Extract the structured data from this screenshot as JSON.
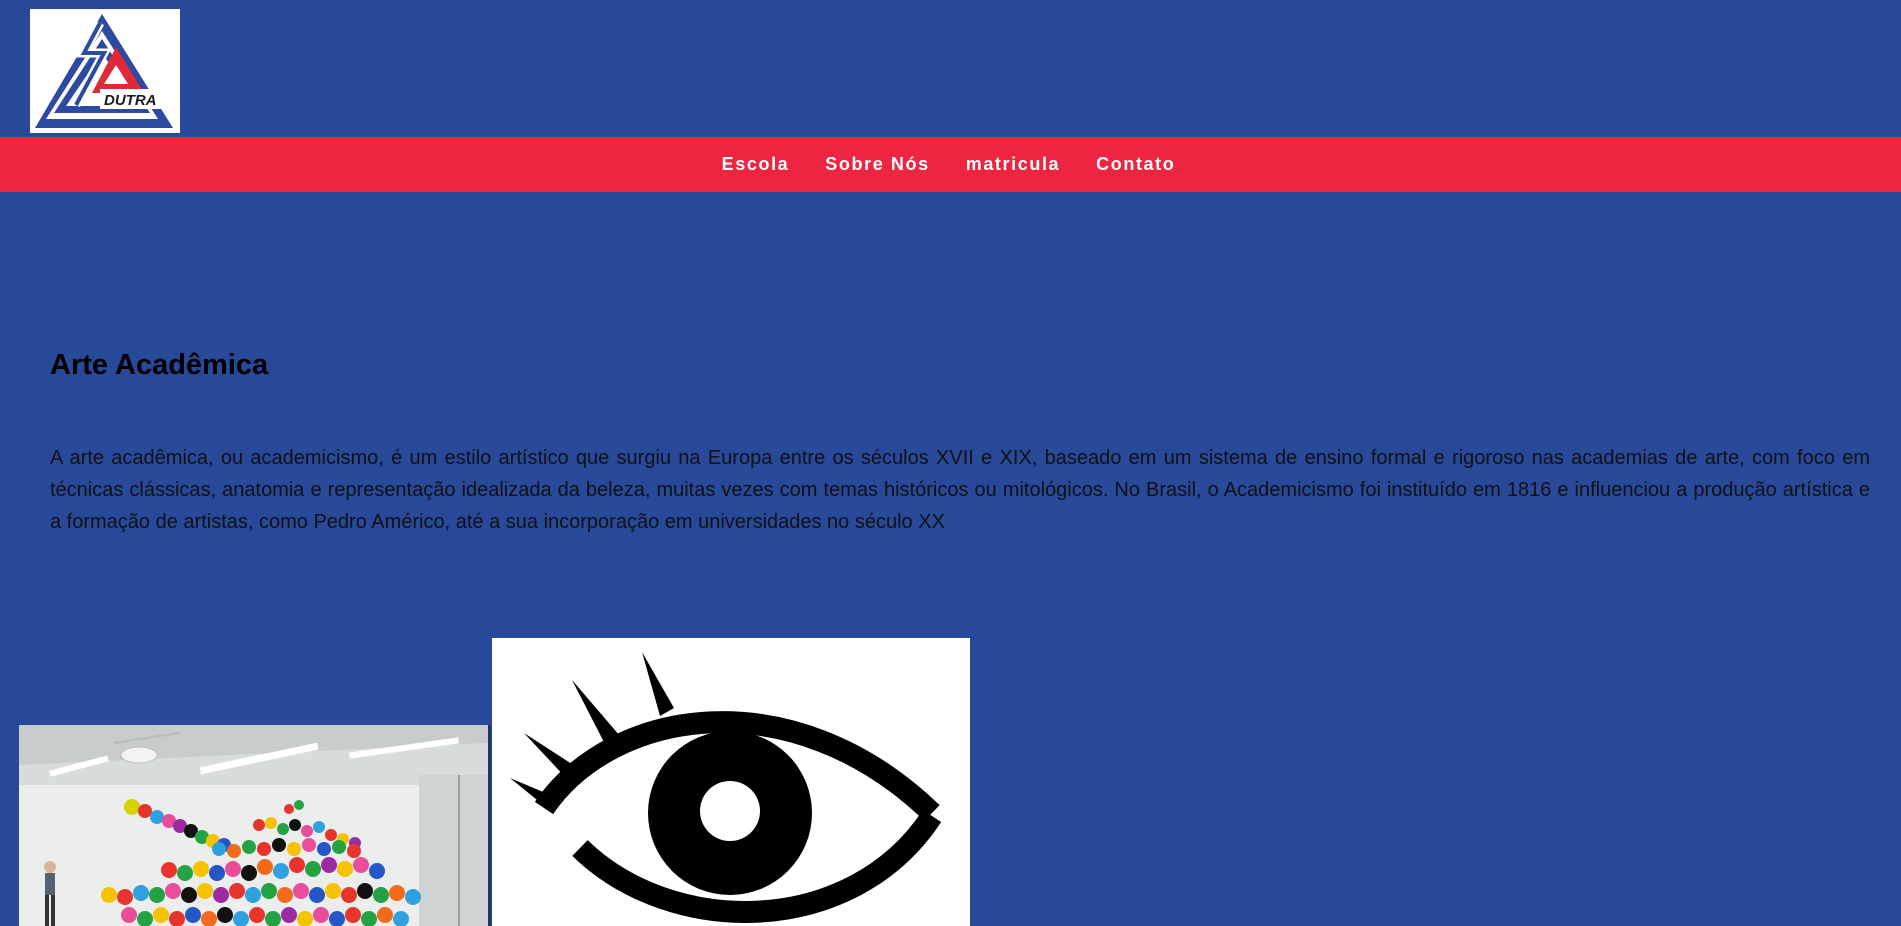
{
  "header": {
    "logo_text": "DUTRA",
    "logo_alt": "ESA Dutra logo"
  },
  "nav": {
    "items": [
      {
        "label": "Escola"
      },
      {
        "label": "Sobre Nós"
      },
      {
        "label": "matricula"
      },
      {
        "label": "Contato"
      }
    ]
  },
  "main": {
    "title": "Arte Acadêmica",
    "paragraph": "A arte acadêmica, ou academicismo, é um estilo artístico que surgiu na Europa entre os séculos XVII e XIX, baseado em um sistema de ensino formal e rigoroso nas academias de arte, com foco em técnicas clássicas, anatomia e representação idealizada da beleza, muitas vezes com temas históricos ou mitológicos. No Brasil, o Academicismo foi instituído em 1816 e influenciou a produção artística e a formação de artistas, como Pedro Américo, até a sua incorporação em universidades no século XX"
  },
  "images": {
    "balloons_alt": "balloon sculpture in gallery",
    "eye_alt": "eye icon"
  },
  "colors": {
    "background": "#284899",
    "nav_bar": "#ee2540",
    "nav_text": "#ffffff",
    "text": "#000000"
  }
}
